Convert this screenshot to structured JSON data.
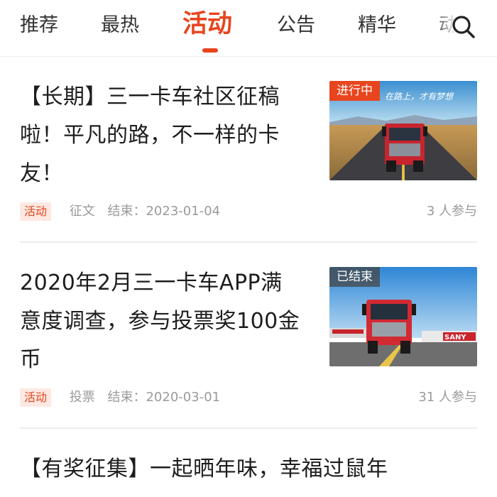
{
  "tabs": [
    {
      "label": "推荐",
      "active": false
    },
    {
      "label": "最热",
      "active": false
    },
    {
      "label": "活动",
      "active": true
    },
    {
      "label": "公告",
      "active": false
    },
    {
      "label": "精华",
      "active": false
    },
    {
      "label": "动",
      "active": false
    }
  ],
  "accent_color": "#e8451e",
  "icons": {
    "search": "search-icon"
  },
  "feed": [
    {
      "title": "【长期】三一卡车社区征稿啦！平凡的路，不一样的卡友！",
      "status": "进行中",
      "thumb_caption": "在路上，才有梦想",
      "tag": "活动",
      "type": "征文",
      "end_label": "结束：",
      "end_date": "2023-01-04",
      "participants": "3 人参与"
    },
    {
      "title": "2020年2月三一卡车APP满意度调查，参与投票奖100金币",
      "status": "已结束",
      "thumb_caption": "SANY",
      "tag": "活动",
      "type": "投票",
      "end_label": "结束：",
      "end_date": "2020-03-01",
      "participants": "31 人参与"
    },
    {
      "title": "【有奖征集】一起晒年味，幸福过鼠年"
    }
  ]
}
